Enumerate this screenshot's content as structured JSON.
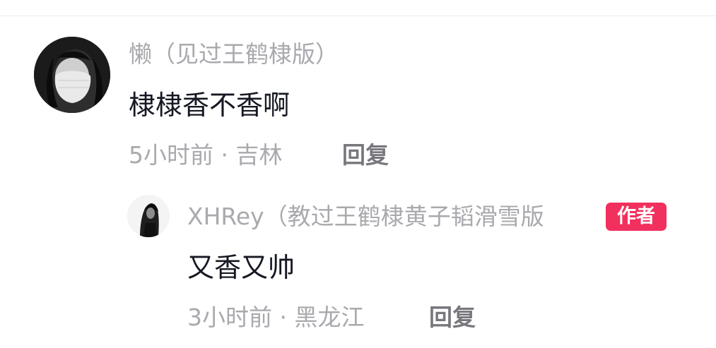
{
  "comment": {
    "user": "懒（见过王鹤棣版）",
    "text": "棣棣香不香啊",
    "meta": "5小时前 · 吉林",
    "reply_label": "回复"
  },
  "reply_comment": {
    "user": "XHRey（教过王鹤棣黄子韬滑雪版",
    "badge": "作者",
    "text": "又香又帅",
    "meta": "3小时前 · 黑龙江",
    "reply_label": "回复"
  },
  "colors": {
    "name": "#a9a9ae",
    "text": "#161823",
    "reply": "#77777d",
    "badge": "#f1305e"
  }
}
